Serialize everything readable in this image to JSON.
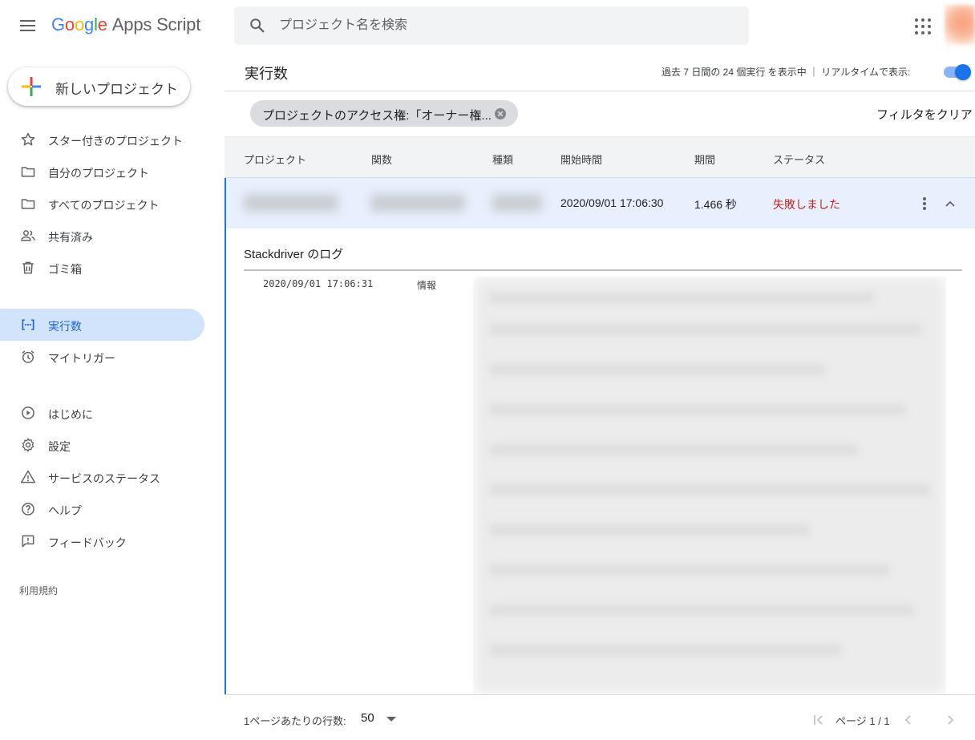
{
  "header": {
    "logo_google": "Google",
    "logo_product": "Apps Script",
    "search_placeholder": "プロジェクト名を検索"
  },
  "sidebar": {
    "new_project_label": "新しいプロジェクト",
    "items": [
      {
        "label": "スター付きのプロジェクト",
        "icon": "star-icon"
      },
      {
        "label": "自分のプロジェクト",
        "icon": "folder-icon"
      },
      {
        "label": "すべてのプロジェクト",
        "icon": "folder-icon"
      },
      {
        "label": "共有済み",
        "icon": "people-icon"
      },
      {
        "label": "ゴミ箱",
        "icon": "trash-icon"
      },
      {
        "label": "実行数",
        "icon": "executions-icon",
        "active": true
      },
      {
        "label": "マイトリガー",
        "icon": "alarm-icon"
      },
      {
        "label": "はじめに",
        "icon": "play-circle-icon"
      },
      {
        "label": "設定",
        "icon": "gear-icon"
      },
      {
        "label": "サービスのステータス",
        "icon": "warning-icon"
      },
      {
        "label": "ヘルプ",
        "icon": "help-icon"
      },
      {
        "label": "フィードバック",
        "icon": "feedback-icon"
      }
    ],
    "terms_label": "利用規約"
  },
  "main": {
    "title": "実行数",
    "summary": "過去 7 日間の 24 個実行 を表示中 ｜ リアルタイムで表示:",
    "realtime_on": true,
    "filter_chip": "プロジェクトのアクセス権:「オーナー権...",
    "clear_filter": "フィルタをクリア",
    "columns": [
      "プロジェクト",
      "関数",
      "種類",
      "開始時間",
      "期間",
      "ステータス"
    ],
    "row": {
      "start_time": "2020/09/01 17:06:30",
      "duration": "1.466 秒",
      "status": "失敗しました"
    },
    "log": {
      "title": "Stackdriver のログ",
      "time": "2020/09/01 17:06:31",
      "level": "情報"
    },
    "footer": {
      "rows_label": "1ページあたりの行数:",
      "rows_value": "50",
      "page_label": "ページ 1 / 1"
    }
  },
  "colors": {
    "accent": "#1a73e8",
    "active_bg": "#d2e3fc",
    "error": "#c5221f"
  }
}
